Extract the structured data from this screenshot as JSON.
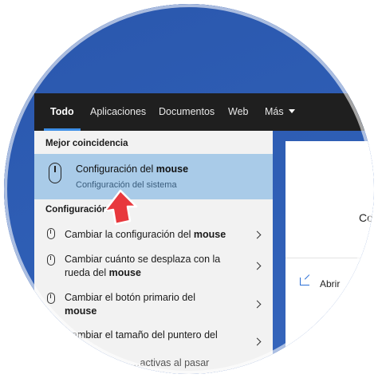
{
  "tabs": [
    {
      "label": "Todo",
      "active": true
    },
    {
      "label": "Aplicaciones"
    },
    {
      "label": "Documentos"
    },
    {
      "label": "Web"
    },
    {
      "label": "Más"
    }
  ],
  "best_match": {
    "section": "Mejor coincidencia",
    "title_prefix": "Configuración del ",
    "title_bold": "mouse",
    "subtitle": "Configuración del sistema"
  },
  "settings_section": "Configuración",
  "items": [
    {
      "text": "Cambiar la configuración del ",
      "bold": "mouse",
      "after": ""
    },
    {
      "line1": "Cambiar cuánto se desplaza con la",
      "line2_text": "rueda del ",
      "line2_bold": "mouse"
    },
    {
      "line1": "Cambiar el botón primario del",
      "line2_bold": "mouse"
    },
    {
      "text": "Cambiar el tamaño del puntero del"
    },
    {
      "text": "…activas al pasar"
    }
  ],
  "preview": {
    "title": "Co",
    "open_label": "Abrir"
  },
  "colors": {
    "accent": "#3d8ee6",
    "selection": "#a9cbe8",
    "taskbar": "#1f1f1f",
    "pointer": "#e8383d"
  },
  "icons": {
    "mouse": "mouse-icon",
    "open": "open-icon",
    "chevron": "chevron-right-icon"
  }
}
